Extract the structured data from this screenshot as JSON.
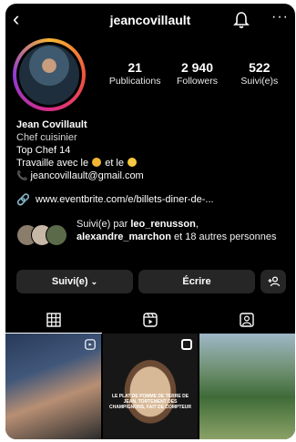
{
  "header": {
    "back_glyph": "‹",
    "username": "jeancovillault",
    "more_glyph": "···"
  },
  "profile": {
    "stats": [
      {
        "value": "21",
        "label": "Publications"
      },
      {
        "value": "2 940",
        "label": "Followers"
      },
      {
        "value": "522",
        "label": "Suivi(e)s"
      }
    ],
    "name": "Jean Covillault",
    "category": "Chef cuisinier",
    "bio_line1": "Top Chef 14",
    "bio_line2_prefix": "Travaille avec le",
    "bio_line2_mid": "et le",
    "email": "jeancovillault@gmail.com",
    "link": "www.eventbrite.com/e/billets-diner-de-..."
  },
  "followed_by": {
    "prefix": "Suivi(e) par",
    "user1": "leo_renusson",
    "user2": "alexandre_marchon",
    "suffix": "et 18 autres personnes"
  },
  "actions": {
    "following_label": "Suivi(e)",
    "following_chevron": "⌄",
    "message_label": "Écrire"
  },
  "grid_posts": [
    {
      "caption": ""
    },
    {
      "caption": "LE PLAT DE POMME DE TERRE DE JEAN. TORTEMENT DES CHAMPIGNONS, FAIT DE COMPTEUR"
    },
    {
      "caption": ""
    }
  ],
  "colors": {
    "background": "#000000",
    "button_bg": "#262626",
    "text": "#ffffff"
  }
}
